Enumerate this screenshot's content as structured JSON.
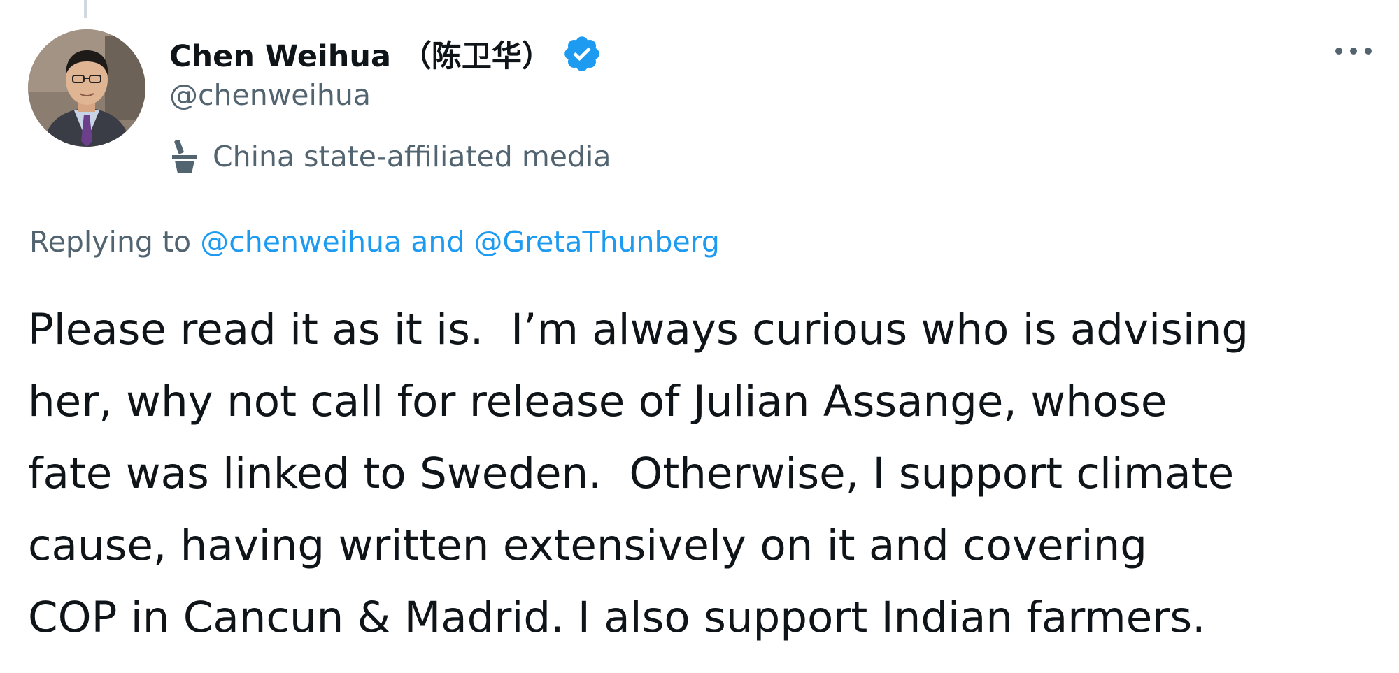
{
  "author": {
    "display_name": "Chen Weihua （陈卫华）",
    "handle": "@chenweihua",
    "verified_icon": "verified-badge-icon",
    "affiliation_icon": "podium-icon",
    "affiliation_label": "China state-affiliated media",
    "avatar_icon": "avatar-photo"
  },
  "menu": {
    "more_label": "···",
    "more_icon": "more-options-icon"
  },
  "reply": {
    "prefix": "Replying to ",
    "mention_1": "@chenweihua",
    "joiner": " and ",
    "mention_2": "@GretaThunberg"
  },
  "tweet": {
    "lines": [
      "Please read it as it is.  I’m always curious who is advising",
      "her, why not call for release of Julian Assange, whose",
      "fate was linked to Sweden.  Otherwise, I support climate",
      "cause, having written extensively on it and covering",
      "COP in Cancun & Madrid. I also support Indian farmers."
    ]
  },
  "colors": {
    "text_primary": "#0f1419",
    "text_secondary": "#536471",
    "accent": "#1d9bf0",
    "thread_line": "#cfd9de"
  }
}
